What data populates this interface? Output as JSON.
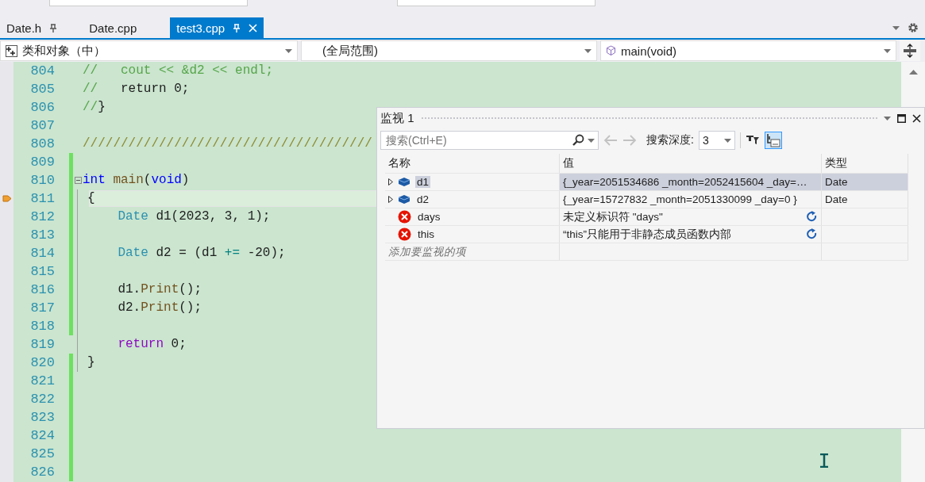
{
  "tabs": [
    {
      "label": "Date.h",
      "selected": false,
      "pinned": true
    },
    {
      "label": "Date.cpp",
      "selected": false,
      "pinned": false
    },
    {
      "label": "test3.cpp",
      "selected": true,
      "pinned": true
    }
  ],
  "nav_bar": [
    {
      "kind": "class",
      "label": "类和对象（中）"
    },
    {
      "kind": "scope",
      "label": "(全局范围)"
    },
    {
      "kind": "member",
      "label": "main(void)"
    }
  ],
  "editor": {
    "lines": [
      {
        "number": "804",
        "tokens": [
          {
            "kind": "comment",
            "t": "//   cout << &d2 << endl;"
          }
        ]
      },
      {
        "number": "805",
        "tokens": [
          {
            "kind": "comment",
            "t": "//"
          },
          {
            "kind": "plain",
            "t": "   return 0;"
          }
        ]
      },
      {
        "number": "806",
        "tokens": [
          {
            "kind": "comment",
            "t": "//"
          },
          {
            "kind": "plain",
            "t": "}"
          }
        ]
      },
      {
        "number": "807"
      },
      {
        "number": "808",
        "tokens": [
          {
            "kind": "divider",
            "t": "//////////////////////////////////////"
          }
        ]
      },
      {
        "number": "809",
        "changed": true
      },
      {
        "number": "810",
        "tokens": [
          {
            "kind": "keyword",
            "t": "int"
          },
          {
            "kind": "func",
            "t": " main"
          },
          {
            "kind": "plain",
            "t": "("
          },
          {
            "kind": "keyword",
            "t": "void"
          },
          {
            "kind": "plain",
            "t": ")"
          }
        ],
        "changed": true,
        "fold": true
      },
      {
        "number": "811",
        "tokens": [
          {
            "kind": "plain",
            "t": "{"
          }
        ],
        "changed": true,
        "current": true,
        "in_block": true
      },
      {
        "number": "812",
        "tokens": [
          {
            "kind": "type",
            "t": "    Date"
          },
          {
            "kind": "plain",
            "t": " d1(2023, 3, 1);"
          }
        ],
        "changed": true,
        "in_block": true
      },
      {
        "number": "813",
        "changed": true,
        "in_block": true
      },
      {
        "number": "814",
        "tokens": [
          {
            "kind": "type",
            "t": "    Date"
          },
          {
            "kind": "plain",
            "t": " d2 = (d1 "
          },
          {
            "kind": "operator",
            "t": "+="
          },
          {
            "kind": "plain",
            "t": " -20);"
          }
        ],
        "changed": true,
        "in_block": true
      },
      {
        "number": "815",
        "changed": true,
        "in_block": true
      },
      {
        "number": "816",
        "tokens": [
          {
            "kind": "plain",
            "t": "    d1."
          },
          {
            "kind": "func",
            "t": "Print"
          },
          {
            "kind": "plain",
            "t": "();"
          }
        ],
        "changed": true,
        "in_block": true
      },
      {
        "number": "817",
        "tokens": [
          {
            "kind": "plain",
            "t": "    d2."
          },
          {
            "kind": "func",
            "t": "Print"
          },
          {
            "kind": "plain",
            "t": "();"
          }
        ],
        "changed": true,
        "in_block": true
      },
      {
        "number": "818",
        "changed": true,
        "in_block": true
      },
      {
        "number": "819",
        "tokens": [
          {
            "kind": "control",
            "t": "    return"
          },
          {
            "kind": "plain",
            "t": " 0;"
          }
        ],
        "changed": false,
        "in_block": true
      },
      {
        "number": "820",
        "tokens": [
          {
            "kind": "plain",
            "t": "}"
          }
        ],
        "changed": true,
        "in_block": true
      },
      {
        "number": "821",
        "changed": true
      },
      {
        "number": "822",
        "changed": true
      },
      {
        "number": "823",
        "changed": true
      },
      {
        "number": "824",
        "changed": true
      },
      {
        "number": "825",
        "changed": true
      },
      {
        "number": "826",
        "changed": true
      }
    ]
  },
  "watch": {
    "title": "监视 1",
    "search": {
      "placeholder": "搜索(Ctrl+E)"
    },
    "depth_label": "搜索深度:",
    "depth": "3",
    "columns": [
      "名称",
      "值",
      "类型"
    ],
    "rows": [
      {
        "kind": "object",
        "name": "d1",
        "value": "{_year=2051534686 _month=2052415604 _day=…",
        "type": "Date",
        "selected": true
      },
      {
        "kind": "object",
        "name": "d2",
        "value": "{_year=15727832 _month=2051330099 _day=0 }",
        "type": "Date",
        "selected": false
      },
      {
        "kind": "error",
        "name": "days",
        "value": "未定义标识符 \"days\"",
        "selected": false
      },
      {
        "kind": "error",
        "name": "this",
        "value": "“this”只能用于非静态成员函数内部",
        "selected": false
      }
    ],
    "add_placeholder": "添加要监视的项"
  }
}
